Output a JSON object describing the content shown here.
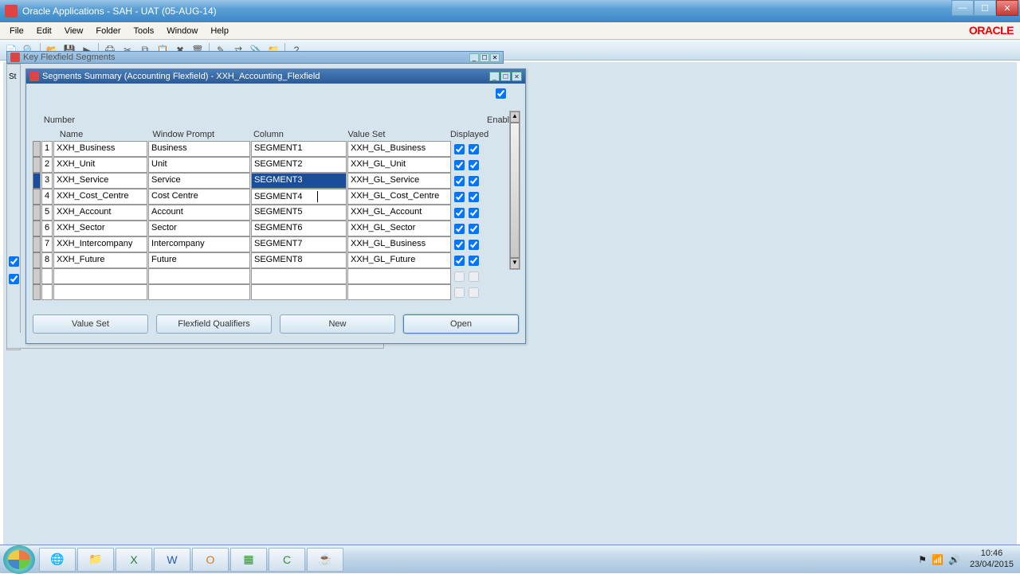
{
  "app_title": "Oracle Applications - SAH - UAT (05-AUG-14)",
  "brand": "ORACLE",
  "menus": [
    "File",
    "Edit",
    "View",
    "Folder",
    "Tools",
    "Window",
    "Help"
  ],
  "bg_window_title": "Key Flexfield Segments",
  "seg_title": "Segments Summary (Accounting Flexfield) - XXH_Accounting_Flexfield",
  "headers": {
    "number": "Number",
    "name": "Name",
    "prompt": "Window Prompt",
    "column": "Column",
    "vset": "Value Set",
    "displayed": "Displayed",
    "enabled": "Enabled"
  },
  "rows": [
    {
      "num": "1",
      "name": "XXH_Business",
      "prompt": "Business",
      "col": "SEGMENT1",
      "vset": "XXH_GL_Business",
      "disp": true,
      "enab": true
    },
    {
      "num": "2",
      "name": "XXH_Unit",
      "prompt": "Unit",
      "col": "SEGMENT2",
      "vset": "XXH_GL_Unit",
      "disp": true,
      "enab": true
    },
    {
      "num": "3",
      "name": "XXH_Service",
      "prompt": "Service",
      "col": "SEGMENT3",
      "vset": "XXH_GL_Service",
      "disp": true,
      "enab": true
    },
    {
      "num": "4",
      "name": "XXH_Cost_Centre",
      "prompt": "Cost Centre",
      "col": "SEGMENT4",
      "vset": "XXH_GL_Cost_Centre",
      "disp": true,
      "enab": true
    },
    {
      "num": "5",
      "name": "XXH_Account",
      "prompt": "Account",
      "col": "SEGMENT5",
      "vset": "XXH_GL_Account",
      "disp": true,
      "enab": true
    },
    {
      "num": "6",
      "name": "XXH_Sector",
      "prompt": "Sector",
      "col": "SEGMENT6",
      "vset": "XXH_GL_Sector",
      "disp": true,
      "enab": true
    },
    {
      "num": "7",
      "name": "XXH_Intercompany",
      "prompt": "Intercompany",
      "col": "SEGMENT7",
      "vset": "XXH_GL_Business",
      "disp": true,
      "enab": true
    },
    {
      "num": "8",
      "name": "XXH_Future",
      "prompt": "Future",
      "col": "SEGMENT8",
      "vset": "XXH_GL_Future",
      "disp": true,
      "enab": true
    }
  ],
  "empty_rows": 2,
  "active_row_index": 2,
  "caret_row_index": 3,
  "buttons": {
    "value_set": "Value Set",
    "qualifiers": "Flexfield Qualifiers",
    "new": "New",
    "open": "Open"
  },
  "under_label_st": "St",
  "tray": {
    "time": "10:46",
    "date": "23/04/2015"
  }
}
